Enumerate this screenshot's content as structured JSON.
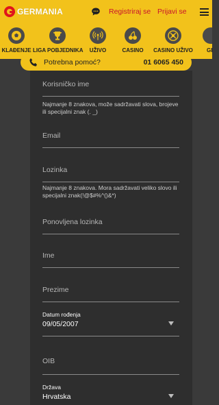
{
  "header": {
    "logo_text": "GERMANIA",
    "register_label": "Registriraj se",
    "login_label": "Prijavi se"
  },
  "categories": [
    {
      "label": "KLAĐENJE",
      "icon": "soccer-ball-icon"
    },
    {
      "label": "LIGA POBJEDNIKA",
      "icon": "trophy-icon"
    },
    {
      "label": "UŽIVO",
      "icon": "live-signal-icon"
    },
    {
      "label": "CASINO",
      "icon": "cherries-icon"
    },
    {
      "label": "CASINO UŽIVO",
      "icon": "roulette-icon"
    },
    {
      "label": "GR",
      "icon": "more-icon"
    }
  ],
  "help": {
    "label": "Potrebna pomoć?",
    "phone": "01 6065 450"
  },
  "form": {
    "username_placeholder": "Korisničko ime",
    "username_hint": "Najmanje 8 znakova, može sadržavati slova, brojeve ili specijalni znak (. _)",
    "email_placeholder": "Email",
    "password_placeholder": "Lozinka",
    "password_hint": "Najmanje 8 znakova. Mora sadržavati veliko slovo ili specijalni znak(!@$#%^()&*)",
    "repeat_password_placeholder": "Ponovljena lozinka",
    "first_name_placeholder": "Ime",
    "last_name_placeholder": "Prezime",
    "birthdate_label": "Datum rođenja",
    "birthdate_value": "09/05/2007",
    "oib_placeholder": "OIB",
    "country_label": "Država",
    "country_value": "Hrvatska"
  },
  "colors": {
    "brand_yellow": "#f2c21b",
    "brand_red": "#c8102e",
    "panel_bg": "#2e2e2e",
    "page_bg": "#3a3a3a"
  }
}
